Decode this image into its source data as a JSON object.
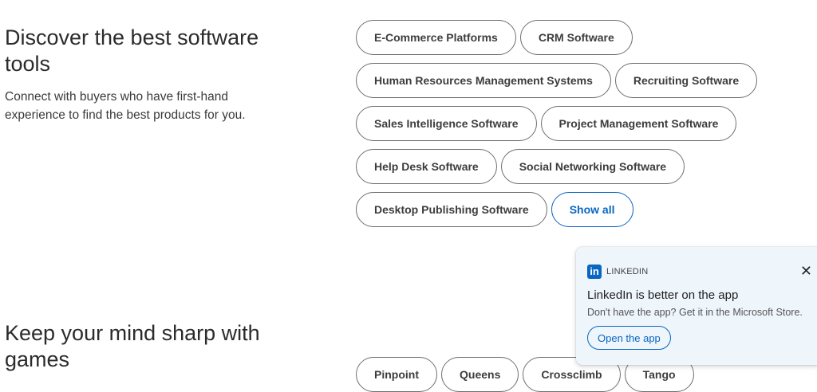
{
  "software": {
    "title": "Discover the best software tools",
    "description": "Connect with buyers who have first-hand experience to find the best products for you.",
    "rows": [
      [
        "E-Commerce Platforms",
        "CRM Software"
      ],
      [
        "Human Resources Management Systems",
        "Recruiting Software"
      ],
      [
        "Sales Intelligence Software",
        "Project Management Software"
      ],
      [
        "Help Desk Software",
        "Social Networking Software"
      ],
      [
        "Desktop Publishing Software"
      ]
    ],
    "show_all_label": "Show all"
  },
  "games": {
    "title": "Keep your mind sharp with games",
    "items": [
      "Pinpoint",
      "Queens",
      "Crossclimb",
      "Tango"
    ]
  },
  "toast": {
    "brand": "LINKEDIN",
    "logo_text": "in",
    "title": "LinkedIn is better on the app",
    "subtitle": "Don't have the app? Get it in the Microsoft Store.",
    "button_label": "Open the app",
    "close_glyph": "✕"
  }
}
